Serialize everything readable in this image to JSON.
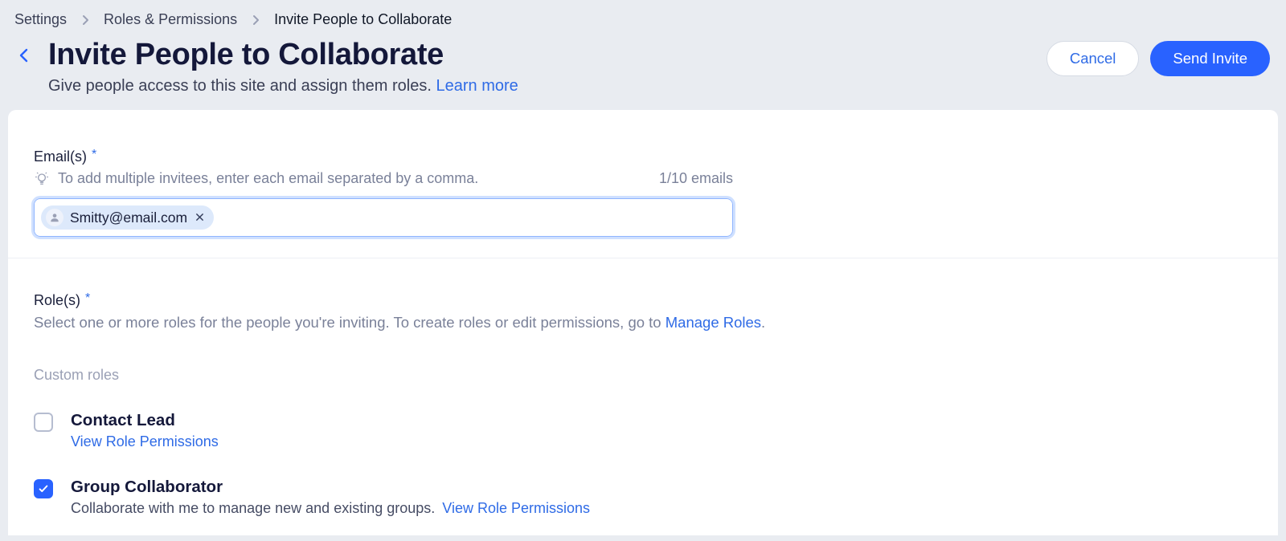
{
  "breadcrumb": {
    "item1": "Settings",
    "item2": "Roles & Permissions",
    "item3": "Invite People to Collaborate"
  },
  "header": {
    "title": "Invite People to Collaborate",
    "subtitle": "Give people access to this site and assign them roles. ",
    "learn_more": "Learn more"
  },
  "actions": {
    "cancel": "Cancel",
    "send": "Send Invite"
  },
  "emails": {
    "label": "Email(s)",
    "hint": "To add multiple invitees, enter each email separated by a comma.",
    "count": "1/10 emails",
    "chip1": "Smitty@email.com"
  },
  "roles": {
    "label": "Role(s)",
    "desc_prefix": "Select one or more roles for the people you're inviting. To create roles or edit permissions, go to ",
    "manage_link": "Manage Roles",
    "period": ".",
    "custom_heading": "Custom roles",
    "item1": {
      "title": "Contact Lead",
      "link": "View Role Permissions"
    },
    "item2": {
      "title": "Group Collaborator",
      "desc": "Collaborate with me to manage new and existing groups.",
      "link": "View Role Permissions"
    }
  }
}
